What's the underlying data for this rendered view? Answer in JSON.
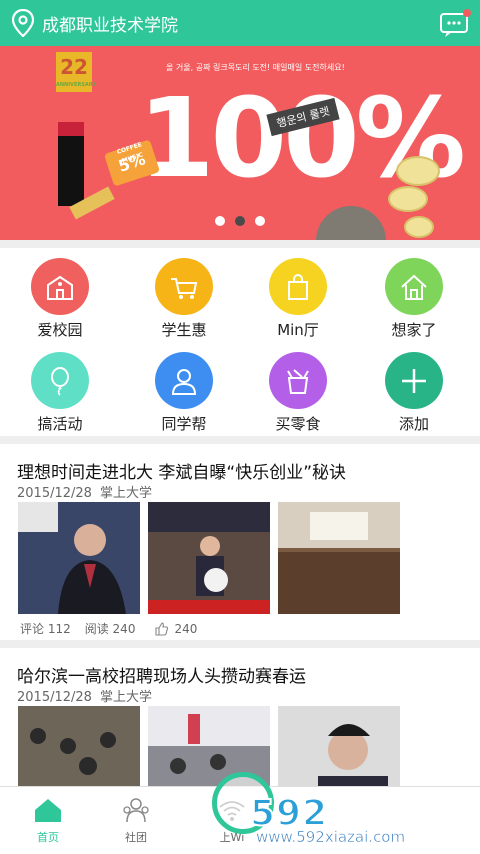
{
  "header": {
    "title": "成都职业技术学院",
    "location_icon": "location-pin-icon",
    "message_icon": "message-icon",
    "accent": "#2fc79a"
  },
  "banner": {
    "subtitle": "올 거울, 공짜 링크목도리 도전! 매일매일 도전하세요!",
    "headline": "100%",
    "ribbon": "행운의 룰렛",
    "tag_value": "5%",
    "tag_small": "COFFEE MUSIC",
    "badge": "22",
    "badge_small": "ANNIVERSARY",
    "slide_count": 3,
    "active_slide": 1,
    "bg": "#f25c5e"
  },
  "grid": [
    {
      "label": "爱校园",
      "icon": "school-icon",
      "color": "#f0605e"
    },
    {
      "label": "学生惠",
      "icon": "cart-icon",
      "color": "#f7b416"
    },
    {
      "label": "Min厅",
      "icon": "shopping-bag-icon",
      "color": "#f5d320"
    },
    {
      "label": "想家了",
      "icon": "home-icon",
      "color": "#7fd45a"
    },
    {
      "label": "搞活动",
      "icon": "balloon-icon",
      "color": "#5fe0c6"
    },
    {
      "label": "同学帮",
      "icon": "user-icon",
      "color": "#3d8ef0"
    },
    {
      "label": "买零食",
      "icon": "snack-box-icon",
      "color": "#b45fe8"
    },
    {
      "label": "添加",
      "icon": "plus-icon",
      "color": "#29b488"
    }
  ],
  "news": [
    {
      "title": "理想时间走进北大 李斌自曝“快乐创业”秘诀",
      "date": "2015/12/28",
      "source": "掌上大学",
      "comments": "评论 112",
      "reads": "阅读 240",
      "likes": "240"
    },
    {
      "title": "哈尔滨一高校招聘现场人头攒动赛春运",
      "date": "2015/12/28",
      "source": "掌上大学"
    }
  ],
  "tabs": [
    {
      "label": "首页",
      "icon": "home-tab-icon",
      "active": true
    },
    {
      "label": "社团",
      "icon": "group-tab-icon",
      "active": false
    },
    {
      "label": "上Wi",
      "icon": "wifi-tab-icon",
      "active": false
    }
  ],
  "watermark": {
    "brand": "592软件园",
    "url": "www.592xiazai.com"
  }
}
